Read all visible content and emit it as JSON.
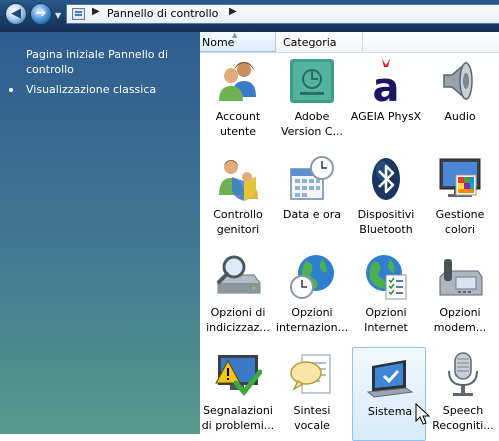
{
  "address_bar": {
    "breadcrumb": "Pannello di controllo",
    "separator": "▶"
  },
  "nav": {
    "back_glyph": "◀",
    "forward_glyph": "➔",
    "dropdown_glyph": "▼"
  },
  "left_pane": {
    "home_link": "Pagina iniziale Pannello di controllo",
    "classic_view": "Visualizzazione classica"
  },
  "columns": {
    "name": "Nome",
    "category": "Categoria"
  },
  "items": [
    {
      "label": "Account utente",
      "icon": "users-icon"
    },
    {
      "label": "Adobe Version C...",
      "icon": "adobe-version-cue-icon"
    },
    {
      "label": "AGEIA PhysX",
      "icon": "ageia-physx-icon"
    },
    {
      "label": "Audio",
      "icon": "speaker-icon"
    },
    {
      "label": "Controllo genitori",
      "icon": "parental-controls-icon"
    },
    {
      "label": "Data e ora",
      "icon": "calendar-clock-icon"
    },
    {
      "label": "Dispositivi Bluetooth",
      "icon": "bluetooth-icon"
    },
    {
      "label": "Gestione colori",
      "icon": "color-management-icon"
    },
    {
      "label": "Opzioni di indicizzaz...",
      "icon": "indexing-icon"
    },
    {
      "label": "Opzioni internazion...",
      "icon": "globe-clock-icon"
    },
    {
      "label": "Opzioni Internet",
      "icon": "internet-options-icon"
    },
    {
      "label": "Opzioni modem...",
      "icon": "phone-modem-icon"
    },
    {
      "label": "Segnalazioni di problemi...",
      "icon": "problem-reports-icon"
    },
    {
      "label": "Sintesi vocale",
      "icon": "speech-bubble-icon"
    },
    {
      "label": "Sistema",
      "icon": "system-monitor-icon",
      "selected": true
    },
    {
      "label": "Speech Recogniti...",
      "icon": "microphone-icon"
    }
  ],
  "colors": {
    "selection_border": "#8cc3ef",
    "left_pane_top": "#2e5d90",
    "left_pane_bottom": "#5a9a8c"
  }
}
